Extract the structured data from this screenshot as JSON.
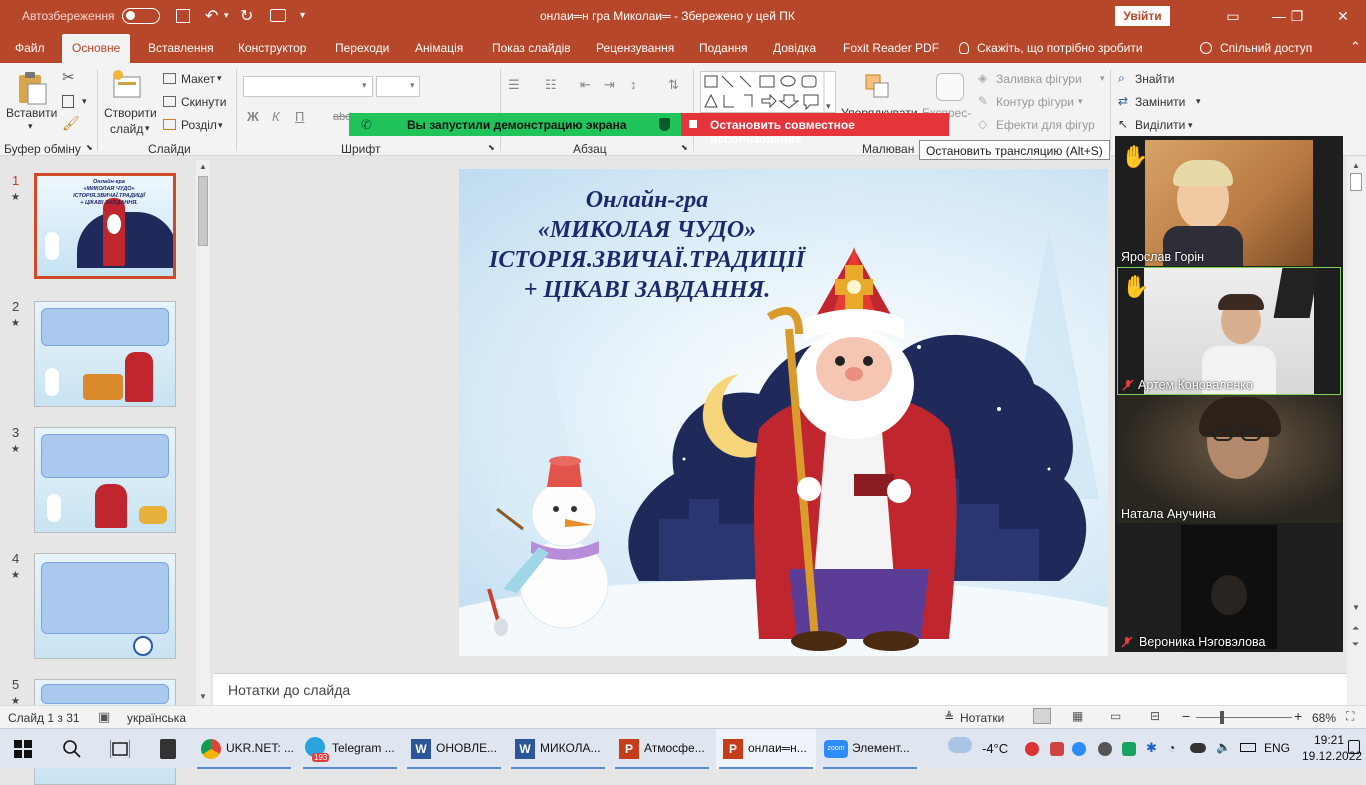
{
  "titlebar": {
    "autosave": "Автозбереження",
    "title": "онлаи═н гра Миколаи═  -  Збережено у цей ПК",
    "signin": "Увійти"
  },
  "tabs": [
    {
      "label": "Файл"
    },
    {
      "label": "Основне"
    },
    {
      "label": "Вставлення"
    },
    {
      "label": "Конструктор"
    },
    {
      "label": "Переходи"
    },
    {
      "label": "Анімація"
    },
    {
      "label": "Показ слайдів"
    },
    {
      "label": "Рецензування"
    },
    {
      "label": "Подання"
    },
    {
      "label": "Довідка"
    },
    {
      "label": "Foxit Reader PDF"
    },
    {
      "label": "Скажіть, що потрібно зробити"
    },
    {
      "label": "Спільний доступ"
    }
  ],
  "ribbon": {
    "paste": "Вставити",
    "new_slide_1": "Створити",
    "new_slide_2": "слайд",
    "layout": "Макет",
    "reset": "Скинути",
    "section": "Розділ",
    "clipboard": "Буфер обміну",
    "slides": "Слайди",
    "font": "Шрифт",
    "paragraph": "Абзац",
    "drawing": "Малюван",
    "arrange": "Упорядкувати",
    "express": "Експрес-",
    "fill": "Заливка фігури",
    "outline": "Контур фігури",
    "effects": "Ефекти для фігур",
    "find": "Знайти",
    "replace": "Замінити",
    "select": "Виділити",
    "bold": "Ж",
    "italic": "К",
    "underline": "П",
    "strike": "abc"
  },
  "share": {
    "started": "Вы запустили демонстрацию экрана",
    "stop": "Остановить совместное использование",
    "tooltip": "Остановить трансляцию (Alt+S)"
  },
  "slide": {
    "line1": "Онлайн-гра",
    "line2": "«МИКОЛАЯ ЧУДО»",
    "line3": "ІСТОРІЯ.ЗВИЧАЇ.ТРАДИЦІЇ",
    "line4": "+ ЦІКАВІ ЗАВДАННЯ."
  },
  "thumbnails": [
    {
      "num": "1",
      "star": "★"
    },
    {
      "num": "2",
      "star": "★"
    },
    {
      "num": "3",
      "star": "★"
    },
    {
      "num": "4",
      "star": "★"
    },
    {
      "num": "5",
      "star": "★"
    }
  ],
  "notes": "Нотатки до слайда",
  "status": {
    "slide": "Слайд 1 з 31",
    "lang": "українська",
    "notes": "Нотатки",
    "zoom": "68%",
    "zoom_level": 0.68
  },
  "participants": [
    {
      "name": "Ярослав Горін",
      "hand": "✋"
    },
    {
      "name": "Артем Коноваленко",
      "hand": "✋"
    },
    {
      "name": "Натала Анучина"
    },
    {
      "name": "Вероника Нэговэлова"
    }
  ],
  "taskbar": {
    "apps": [
      {
        "label": "UKR.NET: ..."
      },
      {
        "label": "Telegram ...",
        "badge": "193"
      },
      {
        "label": "ОНОВЛЕ..."
      },
      {
        "label": "МИКОЛА..."
      },
      {
        "label": "Атмосфе..."
      },
      {
        "label": "онлаи═н..."
      },
      {
        "label": "Элемент..."
      }
    ],
    "weather": "-4°C",
    "lang": "ENG",
    "time": "19:21",
    "date": "19.12.2022"
  },
  "colors": {
    "accent": "#b7472a",
    "share_green": "#21c45a",
    "share_red": "#e5343a",
    "slide_title": "#1b2a6b"
  }
}
